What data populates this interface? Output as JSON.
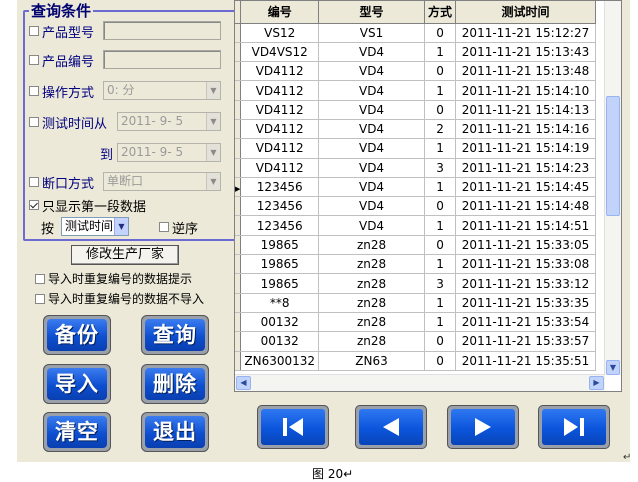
{
  "query": {
    "title": "查询条件",
    "product_model_label": "产品型号",
    "product_number_label": "产品编号",
    "operation_mode_label": "操作方式",
    "operation_mode_value": "0: 分",
    "test_time_from_label": "测试时间从",
    "date_from": "2011- 9- 5",
    "to_label": "到",
    "date_to": "2011- 9- 5",
    "break_mode_label": "断口方式",
    "break_mode_value": "单断口",
    "first_segment_label": "只显示第一段数据",
    "sort_by_label": "按",
    "sort_field": "测试时间",
    "reverse_label": "逆序"
  },
  "manufacturer_button": "修改生产厂家",
  "import_options": {
    "prompt_label": "导入时重复编号的数据提示",
    "skip_label": "导入时重复编号的数据不导入"
  },
  "actions": {
    "backup": "备份",
    "query": "查询",
    "import": "导入",
    "delete": "删除",
    "clear": "清空",
    "exit": "退出"
  },
  "table": {
    "columns": [
      "编号",
      "型号",
      "方式",
      "测试时间"
    ],
    "rows": [
      [
        "VS12",
        "VS1",
        "0",
        "2011-11-21 15:12:27"
      ],
      [
        "VD4VS12",
        "VD4",
        "1",
        "2011-11-21 15:13:43"
      ],
      [
        "VD4112",
        "VD4",
        "0",
        "2011-11-21 15:13:48"
      ],
      [
        "VD4112",
        "VD4",
        "1",
        "2011-11-21 15:14:10"
      ],
      [
        "VD4112",
        "VD4",
        "0",
        "2011-11-21 15:14:13"
      ],
      [
        "VD4112",
        "VD4",
        "2",
        "2011-11-21 15:14:16"
      ],
      [
        "VD4112",
        "VD4",
        "1",
        "2011-11-21 15:14:19"
      ],
      [
        "VD4112",
        "VD4",
        "3",
        "2011-11-21 15:14:23"
      ],
      [
        "123456",
        "VD4",
        "1",
        "2011-11-21 15:14:45"
      ],
      [
        "123456",
        "VD4",
        "0",
        "2011-11-21 15:14:48"
      ],
      [
        "123456",
        "VD4",
        "1",
        "2011-11-21 15:14:51"
      ],
      [
        "19865",
        "zn28",
        "0",
        "2011-11-21 15:33:05"
      ],
      [
        "19865",
        "zn28",
        "1",
        "2011-11-21 15:33:08"
      ],
      [
        "19865",
        "zn28",
        "3",
        "2011-11-21 15:33:12"
      ],
      [
        "**8",
        "zn28",
        "1",
        "2011-11-21 15:33:35"
      ],
      [
        "00132",
        "zn28",
        "1",
        "2011-11-21 15:33:54"
      ],
      [
        "00132",
        "zn28",
        "0",
        "2011-11-21 15:33:57"
      ],
      [
        "ZN6300132",
        "ZN63",
        "0",
        "2011-11-21 15:35:51"
      ]
    ]
  },
  "nav_icons": [
    "first-icon",
    "previous-icon",
    "next-icon",
    "last-icon"
  ],
  "caption": "图 20↵",
  "colors": {
    "window_bg": "#ece9d8",
    "group_border": "#6b6bd1",
    "button_blue": "#0d4fd0",
    "label_blue": "#000080"
  }
}
